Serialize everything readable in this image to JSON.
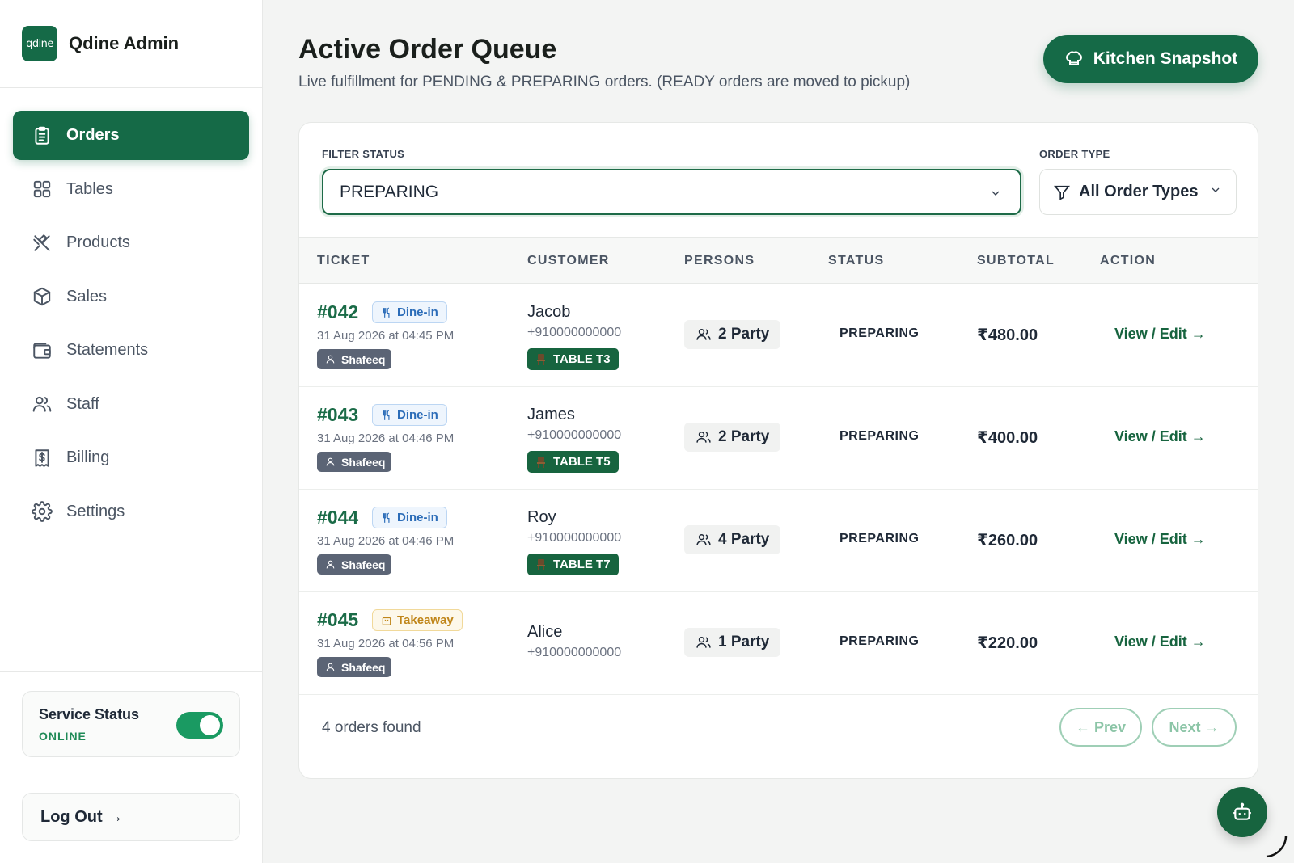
{
  "brand": {
    "logo_text": "qdine",
    "name": "Qdine Admin"
  },
  "sidebar": {
    "items": [
      {
        "label": "Orders",
        "icon": "clipboard-icon",
        "active": true
      },
      {
        "label": "Tables",
        "icon": "grid-icon",
        "active": false
      },
      {
        "label": "Products",
        "icon": "utensils-crossed-icon",
        "active": false
      },
      {
        "label": "Sales",
        "icon": "box-icon",
        "active": false
      },
      {
        "label": "Statements",
        "icon": "wallet-icon",
        "active": false
      },
      {
        "label": "Staff",
        "icon": "users-icon",
        "active": false
      },
      {
        "label": "Billing",
        "icon": "receipt-icon",
        "active": false
      },
      {
        "label": "Settings",
        "icon": "gear-icon",
        "active": false
      }
    ],
    "service": {
      "title": "Service Status",
      "state": "ONLINE",
      "enabled": true
    },
    "logout_label": "Log Out →"
  },
  "header": {
    "title": "Active Order Queue",
    "subtitle": "Live fulfillment for PENDING & PREPARING orders. (READY orders are moved to pickup)",
    "snapshot_label": "Kitchen Snapshot"
  },
  "filters": {
    "status_label": "FILTER STATUS",
    "status_value": "PREPARING",
    "type_label": "ORDER TYPE",
    "type_value": "All Order Types"
  },
  "table": {
    "columns": [
      "TICKET",
      "CUSTOMER",
      "PERSONS",
      "STATUS",
      "SUBTOTAL",
      "ACTION"
    ],
    "rows": [
      {
        "ticket": "#042",
        "type": "Dine-in",
        "date": "31 Aug 2026 at 04:45 PM",
        "staff": "Shafeeq",
        "customer": "Jacob",
        "phone": "+910000000000",
        "table": "TABLE T3",
        "persons": "2 Party",
        "status": "PREPARING",
        "subtotal": "₹480.00",
        "action": "View / Edit →"
      },
      {
        "ticket": "#043",
        "type": "Dine-in",
        "date": "31 Aug 2026 at 04:46 PM",
        "staff": "Shafeeq",
        "customer": "James",
        "phone": "+910000000000",
        "table": "TABLE T5",
        "persons": "2 Party",
        "status": "PREPARING",
        "subtotal": "₹400.00",
        "action": "View / Edit →"
      },
      {
        "ticket": "#044",
        "type": "Dine-in",
        "date": "31 Aug 2026 at 04:46 PM",
        "staff": "Shafeeq",
        "customer": "Roy",
        "phone": "+910000000000",
        "table": "TABLE T7",
        "persons": "4 Party",
        "status": "PREPARING",
        "subtotal": "₹260.00",
        "action": "View / Edit →"
      },
      {
        "ticket": "#045",
        "type": "Takeaway",
        "date": "31 Aug 2026 at 04:56 PM",
        "staff": "Shafeeq",
        "customer": "Alice",
        "phone": "+910000000000",
        "table": "",
        "persons": "1 Party",
        "status": "PREPARING",
        "subtotal": "₹220.00",
        "action": "View / Edit →"
      }
    ]
  },
  "footer": {
    "count_text": "4 orders found",
    "prev_label": "← Prev",
    "next_label": "Next →"
  },
  "colors": {
    "brand_green": "#156a47",
    "accent_green": "#1a9a62",
    "dine_blue": "#2b6cb8",
    "takeaway_amber": "#c0861a"
  }
}
